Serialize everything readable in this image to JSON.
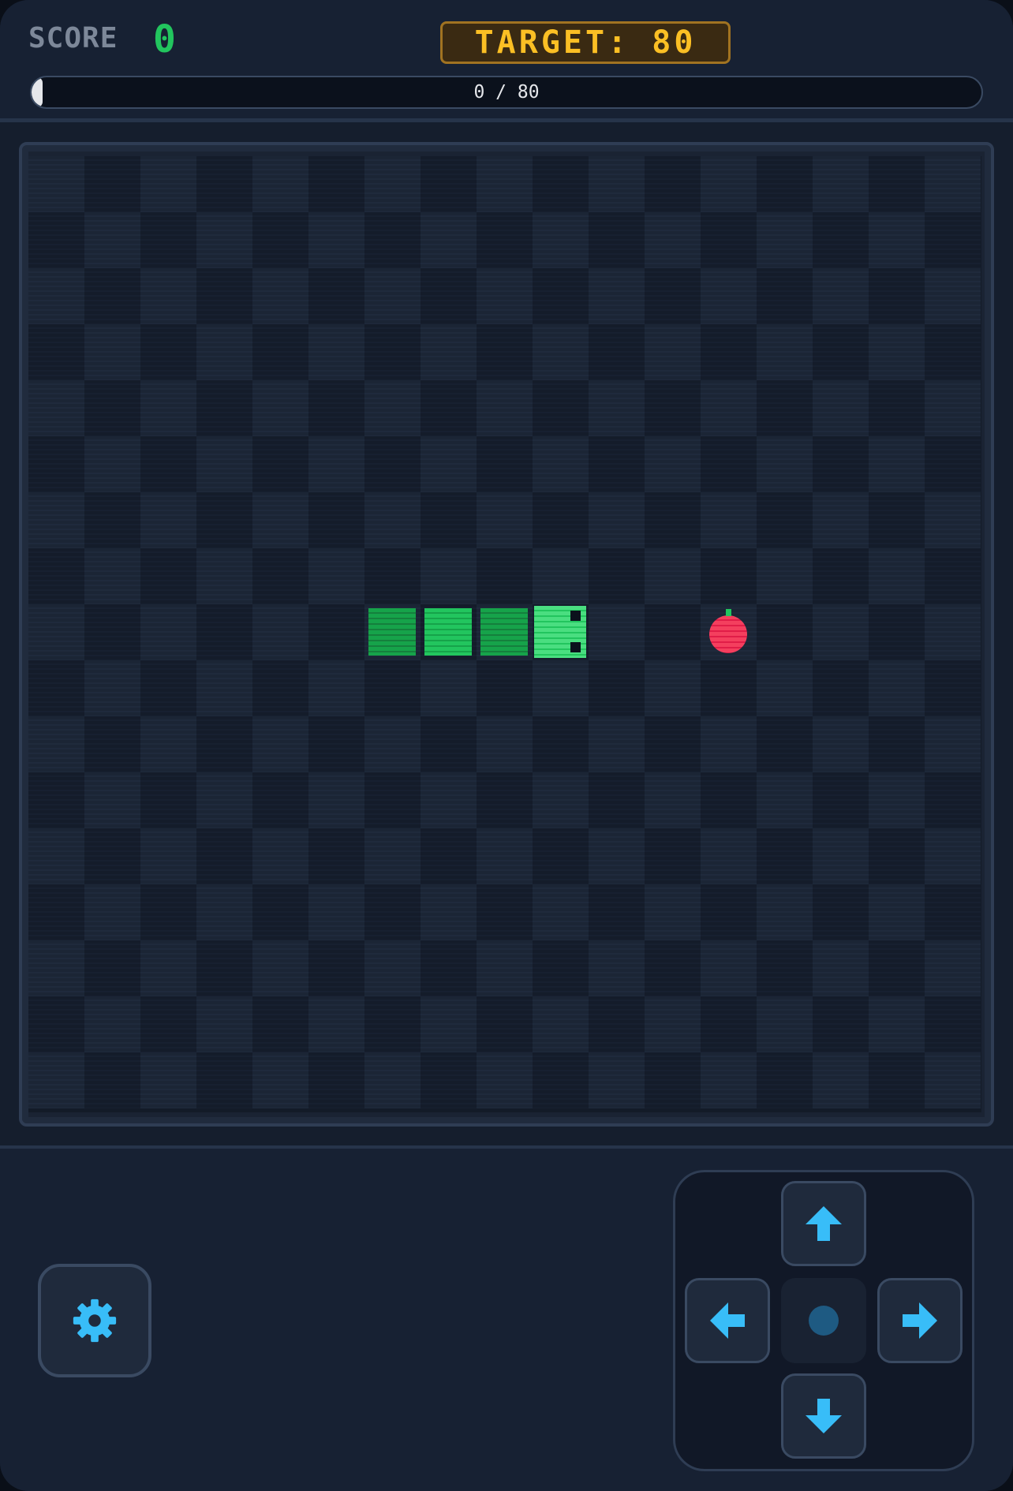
{
  "header": {
    "score_label": "SCORE",
    "score_value": "0",
    "target_label": "TARGET: 80",
    "progress_text": "0 / 80",
    "progress": 0
  },
  "board": {
    "cols": 17,
    "rows": 17,
    "snake": {
      "direction": "right",
      "head": [
        9,
        8
      ],
      "body": [
        [
          8,
          8
        ],
        [
          7,
          8
        ],
        [
          6,
          8
        ]
      ]
    },
    "food": {
      "type": "apple",
      "position": [
        12,
        8
      ]
    }
  },
  "controls": {
    "settings_icon": "gear-icon",
    "dpad": [
      "up",
      "left",
      "right",
      "down"
    ]
  },
  "colors": {
    "snake": "#22c55e",
    "snake_head": "#4ade80",
    "food": "#f43f5e",
    "accent": "#38bdf8",
    "target": "#fbbf24"
  }
}
